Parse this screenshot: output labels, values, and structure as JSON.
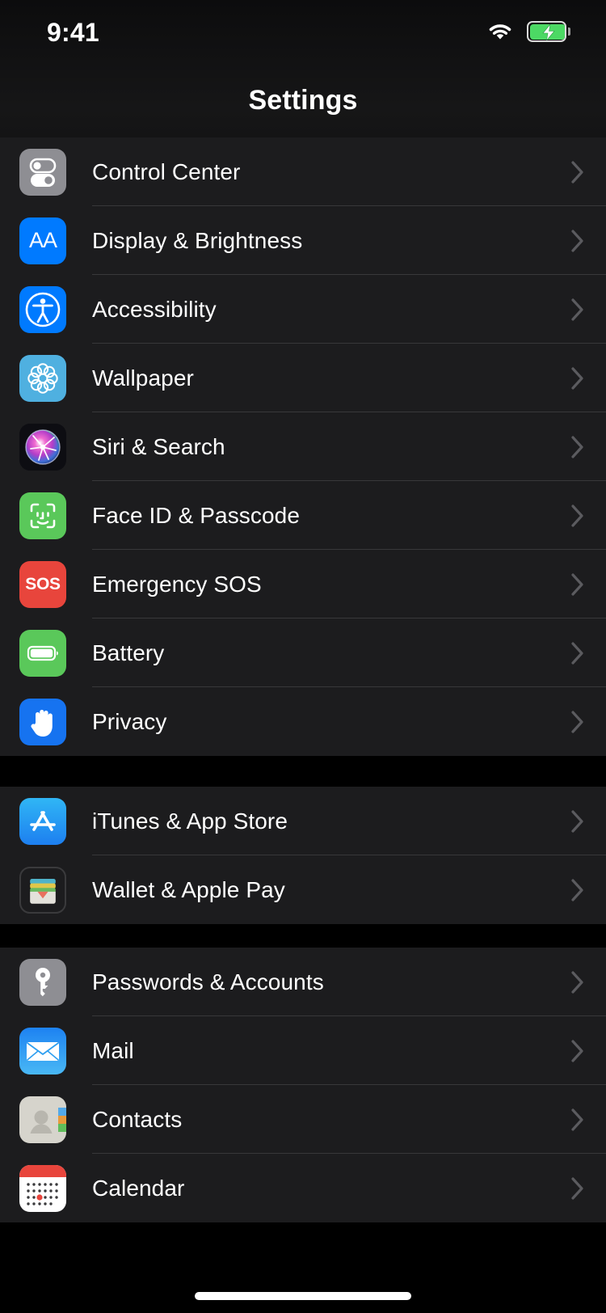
{
  "status_bar": {
    "time": "9:41",
    "wifi_icon": "wifi-icon",
    "battery_icon": "battery-charging-icon",
    "battery_color": "#4cd964"
  },
  "nav": {
    "title": "Settings"
  },
  "theme": {
    "background": "#000000",
    "group_background": "#1c1c1e",
    "separator": "#38383a",
    "label_color": "#ffffff",
    "chevron_color": "#5b5b5f"
  },
  "groups": [
    {
      "name": "system-group",
      "rows": [
        {
          "label": "Control Center",
          "icon": "control-center-icon",
          "icon_color": "#8e8e93"
        },
        {
          "label": "Display & Brightness",
          "icon": "display-brightness-icon",
          "icon_color": "#007aff"
        },
        {
          "label": "Accessibility",
          "icon": "accessibility-icon",
          "icon_color": "#007aff"
        },
        {
          "label": "Wallpaper",
          "icon": "wallpaper-icon",
          "icon_color": "#4fb0e0"
        },
        {
          "label": "Siri & Search",
          "icon": "siri-icon",
          "icon_color": "#0d0d12"
        },
        {
          "label": "Face ID & Passcode",
          "icon": "face-id-icon",
          "icon_color": "#5ac85a"
        },
        {
          "label": "Emergency SOS",
          "icon": "emergency-sos-icon",
          "icon_color": "#e8453c"
        },
        {
          "label": "Battery",
          "icon": "battery-icon",
          "icon_color": "#5ac85a"
        },
        {
          "label": "Privacy",
          "icon": "privacy-hand-icon",
          "icon_color": "#1673f0"
        }
      ]
    },
    {
      "name": "store-group",
      "rows": [
        {
          "label": "iTunes & App Store",
          "icon": "app-store-icon",
          "icon_color": "#1d7ff0"
        },
        {
          "label": "Wallet & Apple Pay",
          "icon": "wallet-icon",
          "icon_color": "#1c1c1e"
        }
      ]
    },
    {
      "name": "accounts-group",
      "rows": [
        {
          "label": "Passwords & Accounts",
          "icon": "passwords-key-icon",
          "icon_color": "#8e8e93"
        },
        {
          "label": "Mail",
          "icon": "mail-icon",
          "icon_color": "#1d82f2"
        },
        {
          "label": "Contacts",
          "icon": "contacts-icon",
          "icon_color": "#d6d4cc"
        },
        {
          "label": "Calendar",
          "icon": "calendar-icon",
          "icon_color": "#ffffff"
        }
      ]
    }
  ],
  "chevron_icon": "chevron-right-icon",
  "home_indicator": "home-indicator"
}
